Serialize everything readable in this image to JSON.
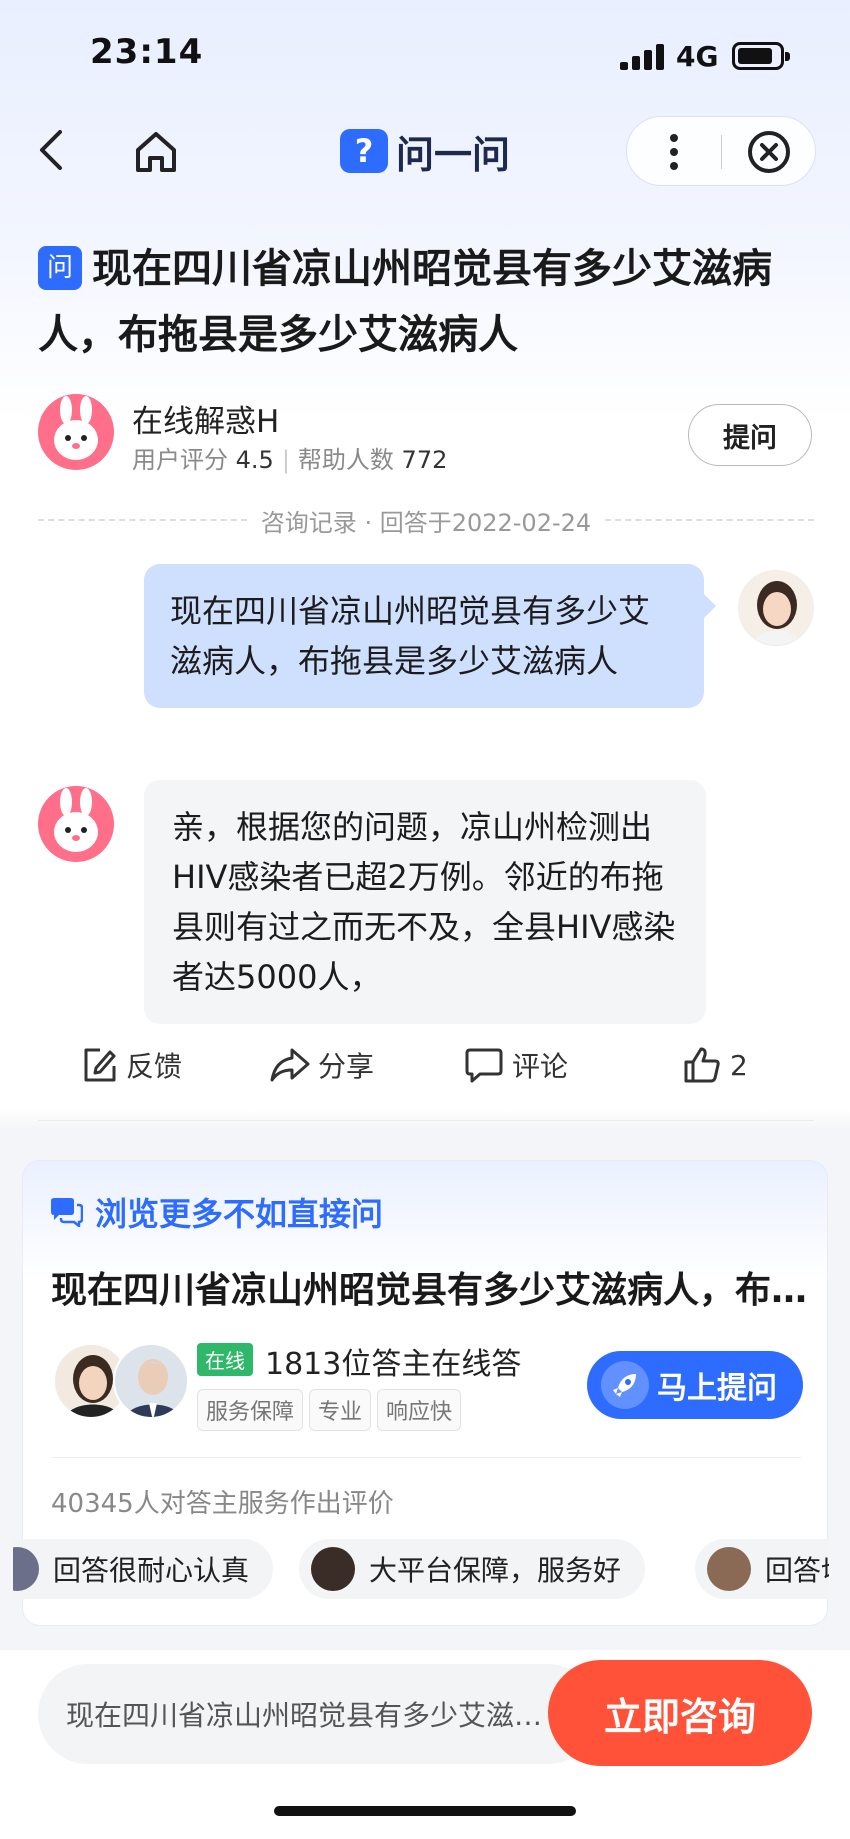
{
  "status_bar": {
    "time": "23:14",
    "network": "4G"
  },
  "nav": {
    "brand_logo": "?",
    "brand_name": "问一问"
  },
  "question": {
    "badge": "问",
    "title": "现在四川省凉山州昭觉县有多少艾滋病人，布拖县是多少艾滋病人"
  },
  "answerer": {
    "name": "在线解惑H",
    "rating_label": "用户评分",
    "rating": "4.5",
    "helped_label": "帮助人数",
    "helped": "772",
    "ask_button": "提问"
  },
  "record": {
    "label": "咨询记录 · 回答于2022-02-24"
  },
  "chat": {
    "user_message": "现在四川省凉山州昭觉县有多少艾滋病人，布拖县是多少艾滋病人",
    "answer": "亲，根据您的问题，凉山州检测出HIV感染者已超2万例。邻近的布拖县则有过之而无不及，全县HIV感染者达5000人，"
  },
  "actions": {
    "feedback": "反馈",
    "share": "分享",
    "comment": "评论",
    "likes": "2"
  },
  "promo": {
    "heading": "浏览更多不如直接问",
    "question": "现在四川省凉山州昭觉县有多少艾滋病人，布拖县是多少艾滋病人",
    "online_tag": "在线",
    "online_text": "1813位答主在线答",
    "tags": [
      "服务保障",
      "专业",
      "响应快"
    ],
    "ask_now": "马上提问",
    "rating_summary": "40345人对答主服务作出评价",
    "reviews": [
      "回答很耐心认真",
      "大平台保障，服务好",
      "回答切"
    ]
  },
  "bottom": {
    "input_text": "现在四川省凉山州昭觉县有多少艾滋病人，布拖县是多少艾滋病人",
    "consult_button": "立即咨询"
  },
  "colors": {
    "accent": "#2e6bff",
    "user_bubble": "#cfe0ff",
    "consult": "#ff5238",
    "online": "#2fb86a"
  }
}
